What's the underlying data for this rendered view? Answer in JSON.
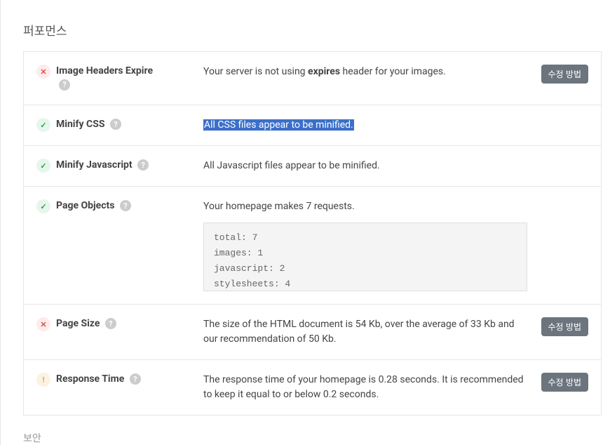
{
  "section": {
    "title": "퍼포먼스"
  },
  "rows": [
    {
      "status": "error",
      "label": "Image Headers Expire",
      "desc_prefix": "Your server is not using ",
      "desc_bold": "expires",
      "desc_suffix": " header for your images.",
      "action": "수정 방법"
    },
    {
      "status": "success",
      "label": "Minify CSS",
      "highlighted": "All CSS files appear to be minified."
    },
    {
      "status": "success",
      "label": "Minify Javascript",
      "desc": "All Javascript files appear to be minified."
    },
    {
      "status": "success",
      "label": "Page Objects",
      "desc": "Your homepage makes 7 requests.",
      "code": {
        "line1": "total: 7",
        "line2": "images: 1",
        "line3": "javascript: 2",
        "line4": "stylesheets: 4"
      }
    },
    {
      "status": "error",
      "label": "Page Size",
      "desc": "The size of the HTML document is 54 Kb, over the average of 33 Kb and our recommendation of 50 Kb.",
      "action": "수정 방법"
    },
    {
      "status": "warning",
      "label": "Response Time",
      "desc": "The response time of your homepage is 0.28 seconds. It is recommended to keep it equal to or below 0.2 seconds.",
      "action": "수정 방법"
    }
  ],
  "bottom": "보안",
  "glyphs": {
    "check": "✓",
    "cross": "✕",
    "warn": "!",
    "help": "?"
  }
}
